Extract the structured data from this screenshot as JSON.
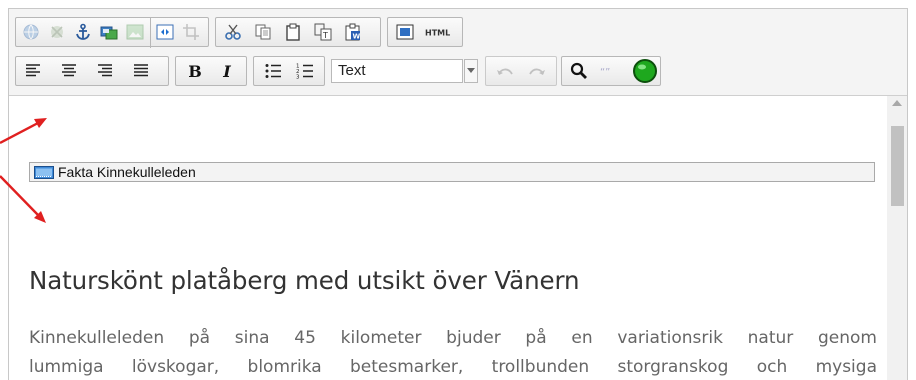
{
  "toolbar": {
    "row1": [
      {
        "icon": "link-globe-icon",
        "enabled": false
      },
      {
        "icon": "unlink-icon",
        "enabled": false
      },
      {
        "icon": "anchor-icon",
        "enabled": true
      },
      {
        "icon": "insert-media-icon",
        "enabled": true
      },
      {
        "icon": "insert-image-icon",
        "enabled": false
      },
      {
        "icon": "insert-content-block-icon",
        "enabled": true
      },
      {
        "icon": "crop-icon",
        "enabled": false
      },
      {
        "icon": "cut-icon",
        "enabled": true
      },
      {
        "icon": "copy-icon",
        "enabled": true
      },
      {
        "icon": "paste-icon",
        "enabled": true
      },
      {
        "icon": "paste-text-icon",
        "enabled": true
      },
      {
        "icon": "paste-word-icon",
        "enabled": true
      },
      {
        "icon": "fullscreen-icon",
        "enabled": true
      },
      {
        "icon": "html-source-icon",
        "label": "HTML",
        "enabled": true
      }
    ],
    "row2": {
      "align_icons": [
        "align-left-icon",
        "align-center-icon",
        "align-right-icon",
        "align-justify-icon"
      ],
      "bold_label": "B",
      "italic_label": "I",
      "list_icons": [
        "bullet-list-icon",
        "numbered-list-icon"
      ],
      "format_select_value": "Text",
      "history_icons": [
        "undo-icon",
        "redo-icon"
      ],
      "tool_icons": [
        "search-icon",
        "quote-icon",
        "status-green-icon"
      ]
    }
  },
  "content": {
    "fakta_block_label": "Fakta Kinnekulleleden",
    "heading": "Naturskönt platåberg med utsikt över Vänern",
    "paragraph_line1": "Kinnekulleleden på sina 45 kilometer bjuder på en variationsrik natur genom",
    "paragraph_line2": "lummiga lövskogar, blomrika betesmarker, trollbunden storgranskog och mysiga"
  },
  "colors": {
    "annotation_arrow": "#e02020",
    "status_green": "#1ea81e",
    "heading_text": "#333333",
    "paragraph_text": "#666666"
  }
}
